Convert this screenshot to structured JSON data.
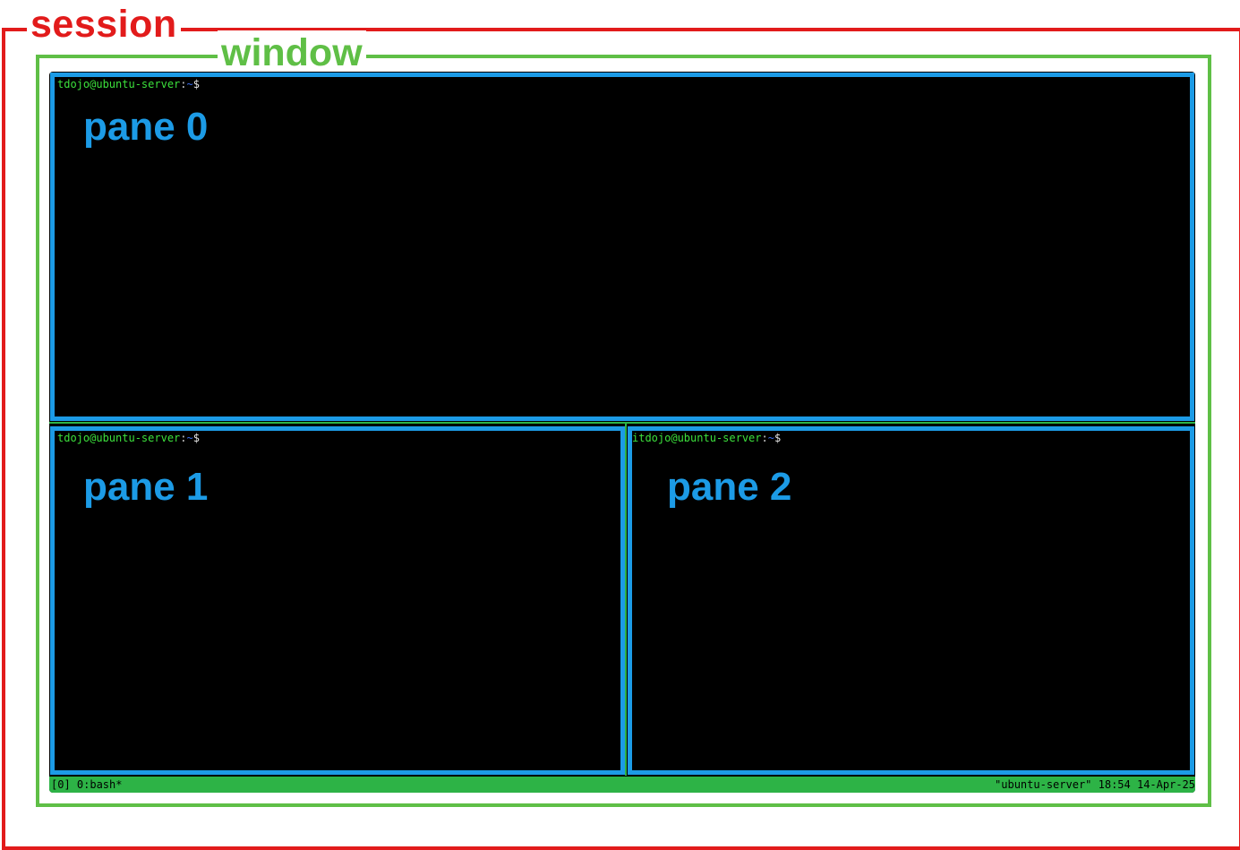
{
  "labels": {
    "session": "session",
    "window": "window"
  },
  "panes": [
    {
      "label": "pane 0",
      "prompt_user": "tdojo@ubuntu-server",
      "prompt_colon": ":",
      "prompt_path": "~",
      "prompt_dollar": "$"
    },
    {
      "label": "pane 1",
      "prompt_user": "tdojo@ubuntu-server",
      "prompt_colon": ":",
      "prompt_path": "~",
      "prompt_dollar": "$"
    },
    {
      "label": "pane 2",
      "prompt_user": "itdojo@ubuntu-server",
      "prompt_colon": ":",
      "prompt_path": "~",
      "prompt_dollar": "$"
    }
  ],
  "status_bar": {
    "left": "[0] 0:bash*",
    "right": "\"ubuntu-server\" 18:54 14-Apr-25"
  },
  "colors": {
    "session": "#e21b1b",
    "window": "#5fbf46",
    "pane": "#1c9be6",
    "status_bar": "#2db346",
    "terminal_bg": "#000000"
  }
}
